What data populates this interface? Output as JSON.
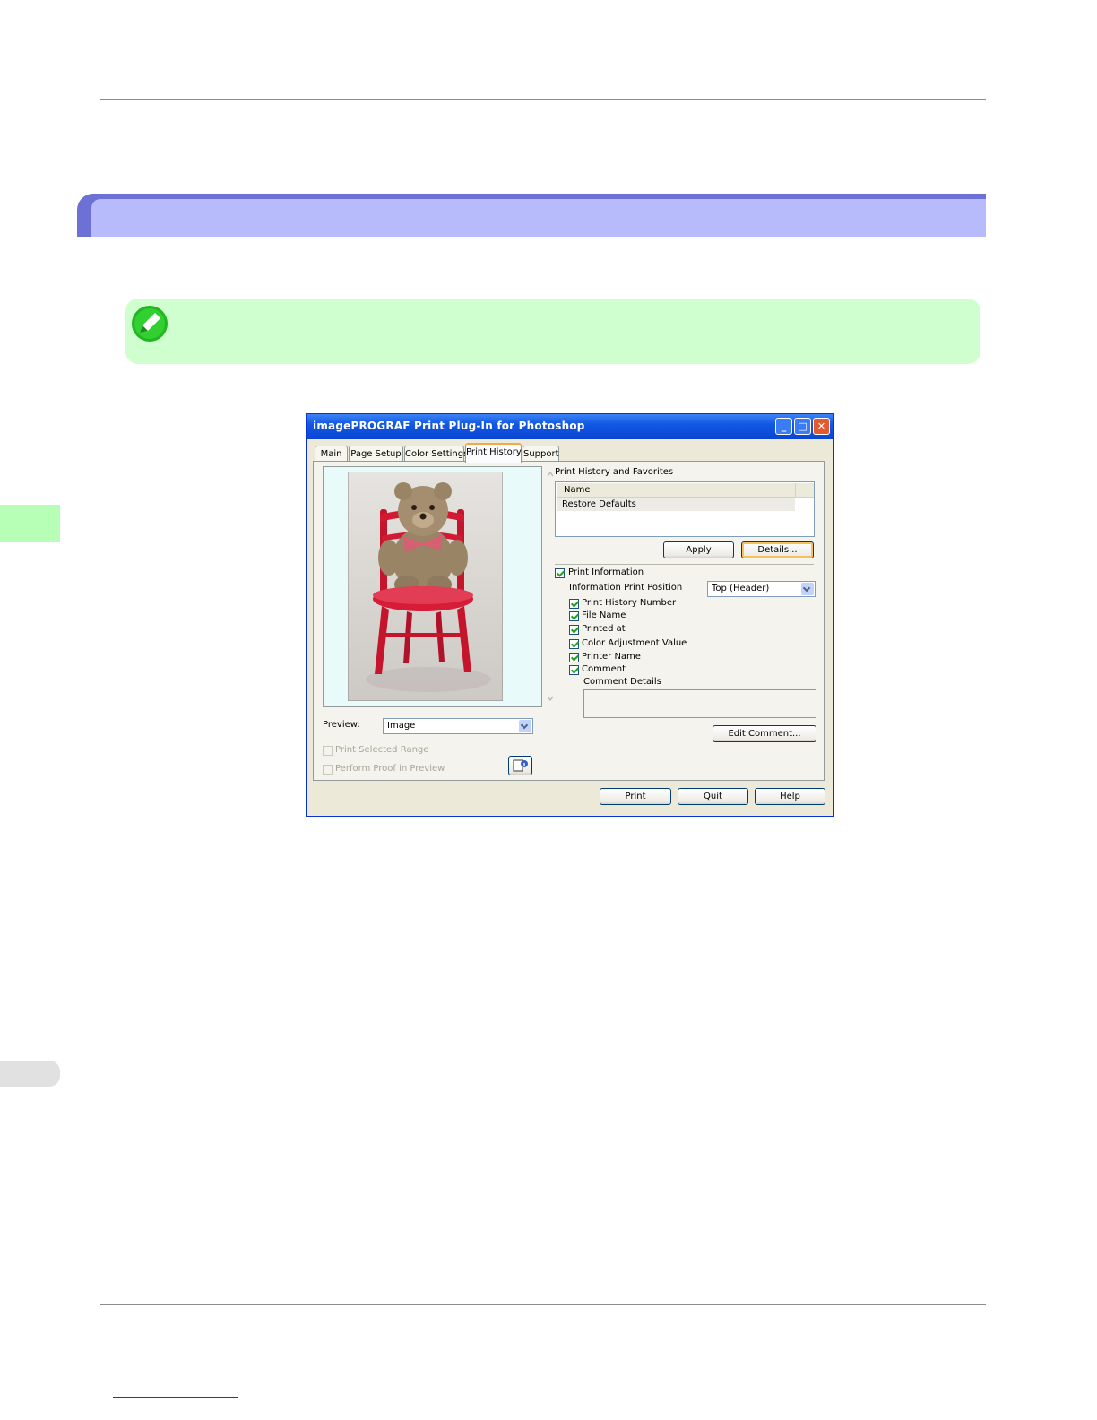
{
  "dialog": {
    "title": "imagePROGRAF Print Plug-In for Photoshop",
    "tabs": [
      "Main",
      "Page Setup",
      "Color Settings",
      "Print History",
      "Support"
    ],
    "history": {
      "group_label": "Print History and Favorites",
      "column_name": "Name",
      "rows": [
        "Restore Defaults"
      ],
      "apply_label": "Apply",
      "details_label": "Details..."
    },
    "print_info": {
      "label": "Print Information",
      "position_label": "Information Print Position",
      "position_value": "Top (Header)",
      "items": [
        "Print History Number",
        "File Name",
        "Printed at",
        "Color Adjustment Value",
        "Printer Name",
        "Comment"
      ],
      "comment_details_label": "Comment Details",
      "edit_comment_label": "Edit Comment..."
    },
    "preview": {
      "label": "Preview:",
      "value": "Image",
      "print_selected_range": "Print Selected Range",
      "perform_proof": "Perform Proof in Preview"
    },
    "buttons": {
      "print": "Print",
      "quit": "Quit",
      "help": "Help"
    }
  },
  "colors": {
    "section_bar": "#b7bbfb",
    "section_accent": "#6d71d6",
    "note_bg": "#cfffcf",
    "titlebar": "#0a45d2"
  }
}
